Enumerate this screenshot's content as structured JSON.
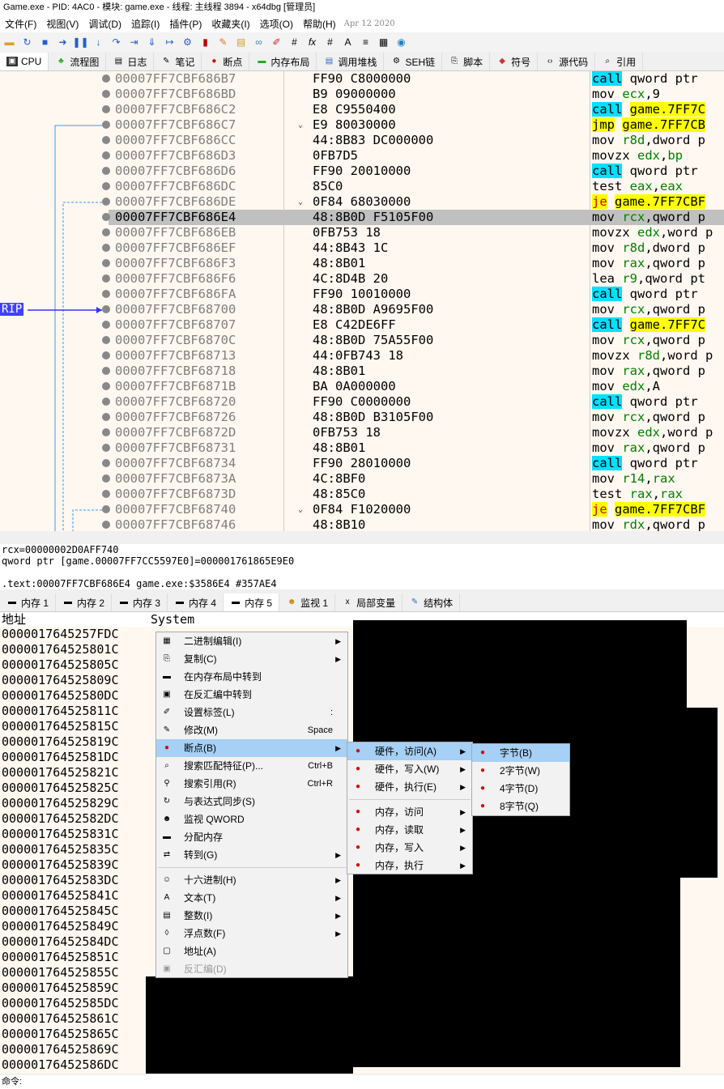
{
  "window": {
    "title": "Game.exe - PID: 4AC0 - 模块: game.exe - 线程: 主线程 3894 - x64dbg [管理员]"
  },
  "menubar": {
    "items": [
      "文件(F)",
      "视图(V)",
      "调试(D)",
      "追踪(I)",
      "插件(P)",
      "收藏夹(I)",
      "选项(O)",
      "帮助(H)"
    ],
    "date": "Apr 12 2020"
  },
  "tabs_top": [
    "CPU",
    "流程图",
    "日志",
    "笔记",
    "断点",
    "内存布局",
    "调用堆栈",
    "SEH链",
    "脚本",
    "符号",
    "源代码",
    "引用"
  ],
  "disasm": {
    "rip_label": "RIP",
    "rows": [
      {
        "addr": "00007FF7CBF686B7",
        "bytes": "FF90 C8000000",
        "mn": "call",
        "ops": " qword ptr"
      },
      {
        "addr": "00007FF7CBF686BD",
        "bytes": "B9 09000000",
        "mn": "mov",
        "ops": " ecx,9"
      },
      {
        "addr": "00007FF7CBF686C2",
        "bytes": "E8 C9550400",
        "mn": "call",
        "ops": " game.7FF7C"
      },
      {
        "addr": "00007FF7CBF686C7",
        "bytes": "E9 80030000",
        "mn": "jmp",
        "ops": " game.7FF7CB"
      },
      {
        "addr": "00007FF7CBF686CC",
        "bytes": "44:8B83 DC000000",
        "mn": "mov",
        "ops": " r8d,dword p"
      },
      {
        "addr": "00007FF7CBF686D3",
        "bytes": "0FB7D5",
        "mn": "movzx",
        "ops": " edx,bp"
      },
      {
        "addr": "00007FF7CBF686D6",
        "bytes": "FF90 20010000",
        "mn": "call",
        "ops": " qword ptr"
      },
      {
        "addr": "00007FF7CBF686DC",
        "bytes": "85C0",
        "mn": "test",
        "ops": " eax,eax"
      },
      {
        "addr": "00007FF7CBF686DE",
        "bytes": "0F84 68030000",
        "mn": "je",
        "ops": " game.7FF7CBF"
      },
      {
        "addr": "00007FF7CBF686E4",
        "bytes": "48:8B0D F5105F00",
        "mn": "mov",
        "ops": " rcx,qword p"
      },
      {
        "addr": "00007FF7CBF686EB",
        "bytes": "0FB753 18",
        "mn": "movzx",
        "ops": " edx,word p"
      },
      {
        "addr": "00007FF7CBF686EF",
        "bytes": "44:8B43 1C",
        "mn": "mov",
        "ops": " r8d,dword p"
      },
      {
        "addr": "00007FF7CBF686F3",
        "bytes": "48:8B01",
        "mn": "mov",
        "ops": " rax,qword p"
      },
      {
        "addr": "00007FF7CBF686F6",
        "bytes": "4C:8D4B 20",
        "mn": "lea",
        "ops": " r9,qword pt"
      },
      {
        "addr": "00007FF7CBF686FA",
        "bytes": "FF90 10010000",
        "mn": "call",
        "ops": " qword ptr"
      },
      {
        "addr": "00007FF7CBF68700",
        "bytes": "48:8B0D A9695F00",
        "mn": "mov",
        "ops": " rcx,qword p"
      },
      {
        "addr": "00007FF7CBF68707",
        "bytes": "E8 C42DE6FF",
        "mn": "call",
        "ops": " game.7FF7C"
      },
      {
        "addr": "00007FF7CBF6870C",
        "bytes": "48:8B0D 75A55F00",
        "mn": "mov",
        "ops": " rcx,qword p"
      },
      {
        "addr": "00007FF7CBF68713",
        "bytes": "44:0FB743 18",
        "mn": "movzx",
        "ops": " r8d,word p"
      },
      {
        "addr": "00007FF7CBF68718",
        "bytes": "48:8B01",
        "mn": "mov",
        "ops": " rax,qword p"
      },
      {
        "addr": "00007FF7CBF6871B",
        "bytes": "BA 0A000000",
        "mn": "mov",
        "ops": " edx,A"
      },
      {
        "addr": "00007FF7CBF68720",
        "bytes": "FF90 C0000000",
        "mn": "call",
        "ops": " qword ptr"
      },
      {
        "addr": "00007FF7CBF68726",
        "bytes": "48:8B0D B3105F00",
        "mn": "mov",
        "ops": " rcx,qword p"
      },
      {
        "addr": "00007FF7CBF6872D",
        "bytes": "0FB753 18",
        "mn": "movzx",
        "ops": " edx,word p"
      },
      {
        "addr": "00007FF7CBF68731",
        "bytes": "48:8B01",
        "mn": "mov",
        "ops": " rax,qword p"
      },
      {
        "addr": "00007FF7CBF68734",
        "bytes": "FF90 28010000",
        "mn": "call",
        "ops": " qword ptr"
      },
      {
        "addr": "00007FF7CBF6873A",
        "bytes": "4C:8BF0",
        "mn": "mov",
        "ops": " r14,rax"
      },
      {
        "addr": "00007FF7CBF6873D",
        "bytes": "48:85C0",
        "mn": "test",
        "ops": " rax,rax"
      },
      {
        "addr": "00007FF7CBF68740",
        "bytes": "0F84 F1020000",
        "mn": "je",
        "ops": " game.7FF7CBF"
      },
      {
        "addr": "00007FF7CBF68746",
        "bytes": "48:8B10",
        "mn": "mov",
        "ops": " rdx,qword p"
      }
    ]
  },
  "info": {
    "line1": "rcx=00000002D0AFF740",
    "line2": "qword ptr [game.00007FF7CC5597E0]=000001761865E9E0",
    "line3": ".text:00007FF7CBF686E4 game.exe:$3586E4 #357AE4"
  },
  "tabs_bottom": [
    "内存 1",
    "内存 2",
    "内存 3",
    "内存 4",
    "内存 5",
    "监视 1",
    "局部变量",
    "结构体"
  ],
  "memview": {
    "col_addr": "地址",
    "col_data": "System",
    "rows": [
      "0000017645257FDC",
      "000001764525801C",
      "000001764525805C",
      "000001764525809C",
      "00000176452580DC",
      "000001764525811C",
      "000001764525815C",
      "000001764525819C",
      "00000176452581DC",
      "000001764525821C",
      "000001764525825C",
      "000001764525829C",
      "00000176452582DC",
      "000001764525831C",
      "000001764525835C",
      "000001764525839C",
      "00000176452583DC",
      "000001764525841C",
      "000001764525845C",
      "000001764525849C",
      "00000176452584DC",
      "000001764525851C",
      "000001764525855C",
      "000001764525859C",
      "00000176452585DC",
      "000001764525861C",
      "000001764525865C",
      "000001764525869C",
      "00000176452586DC"
    ]
  },
  "context_menu": {
    "items": [
      {
        "label": "二进制编辑(I)",
        "sub": true
      },
      {
        "label": "复制(C)",
        "sub": true
      },
      {
        "label": "在内存布局中转到"
      },
      {
        "label": "在反汇编中转到"
      },
      {
        "label": "设置标签(L)",
        "shortcut": ":"
      },
      {
        "label": "修改(M)",
        "shortcut": "Space"
      },
      {
        "label": "断点(B)",
        "sub": true,
        "hl": true
      },
      {
        "label": "搜索匹配特征(P)...",
        "shortcut": "Ctrl+B"
      },
      {
        "label": "搜索引用(R)",
        "shortcut": "Ctrl+R"
      },
      {
        "label": "与表达式同步(S)"
      },
      {
        "label": "监视 QWORD"
      },
      {
        "label": "分配内存"
      },
      {
        "label": "转到(G)",
        "sub": true
      },
      {
        "label": "十六进制(H)",
        "sub": true
      },
      {
        "label": "文本(T)",
        "sub": true
      },
      {
        "label": "整数(I)",
        "sub": true
      },
      {
        "label": "浮点数(F)",
        "sub": true
      },
      {
        "label": "地址(A)"
      },
      {
        "label": "反汇编(D)",
        "dis": true
      }
    ]
  },
  "bp_menu": {
    "items": [
      "硬件，访问(A)",
      "硬件，写入(W)",
      "硬件，执行(E)",
      "内存，访问",
      "内存，读取",
      "内存，写入",
      "内存，执行"
    ]
  },
  "size_menu": {
    "items": [
      "字节(B)",
      "2字节(W)",
      "4字节(D)",
      "8字节(Q)"
    ]
  },
  "command": {
    "label": "命令:"
  }
}
